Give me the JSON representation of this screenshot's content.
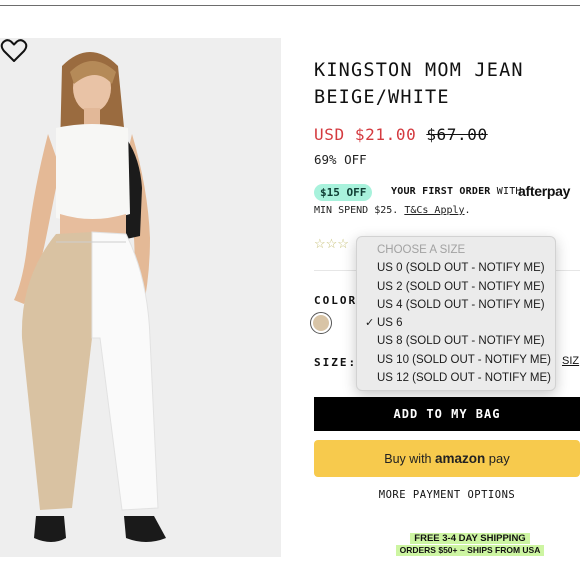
{
  "product": {
    "title": "KINGSTON MOM JEAN BEIGE/WHITE",
    "sale_price": "USD $21.00",
    "original_price": "$67.00",
    "discount": "69% OFF"
  },
  "promo": {
    "badge": "$15 OFF",
    "headline": "YOUR FIRST ORDER",
    "with": "WITH",
    "provider": "afterpay",
    "min_spend": "MIN SPEND $25.",
    "terms_link": "T&Cs Apply",
    "terms_suffix": "."
  },
  "rating": {
    "stars": "☆☆☆"
  },
  "color": {
    "label": "COLOR",
    "selected_swatch_color": "#d8c4a6"
  },
  "size": {
    "label": "SIZE:",
    "guide_link": "SIZ",
    "dropdown": {
      "placeholder": "CHOOSE A SIZE",
      "options": [
        {
          "label": "US 0 (SOLD OUT - NOTIFY ME)",
          "selected": false
        },
        {
          "label": "US 2 (SOLD OUT - NOTIFY ME)",
          "selected": false
        },
        {
          "label": "US 4 (SOLD OUT - NOTIFY ME)",
          "selected": false
        },
        {
          "label": "US 6",
          "selected": true
        },
        {
          "label": "US 8 (SOLD OUT - NOTIFY ME)",
          "selected": false
        },
        {
          "label": "US 10 (SOLD OUT - NOTIFY ME)",
          "selected": false
        },
        {
          "label": "US 12 (SOLD OUT - NOTIFY ME)",
          "selected": false
        }
      ],
      "check_mark": "✓"
    }
  },
  "actions": {
    "add_to_bag": "ADD TO MY BAG",
    "amazon_pay_prefix": "Buy with",
    "amazon_pay_brand": "amazon",
    "amazon_pay_suffix": "pay",
    "more_options": "MORE PAYMENT OPTIONS"
  },
  "shipping": {
    "line1": "FREE 3-4 DAY SHIPPING",
    "line2": "ORDERS $50+ ~ SHIPS FROM USA"
  },
  "colors": {
    "sale_red": "#d43a3f",
    "promo_mint": "#a8f2dc",
    "amazon_yellow": "#f7ca4d",
    "shipping_green": "#cdf5a2",
    "button_black": "#000000"
  },
  "icons": {
    "wishlist": "heart-outline-icon",
    "afterpay": "afterpay-logo-icon",
    "check": "checkmark-icon"
  }
}
